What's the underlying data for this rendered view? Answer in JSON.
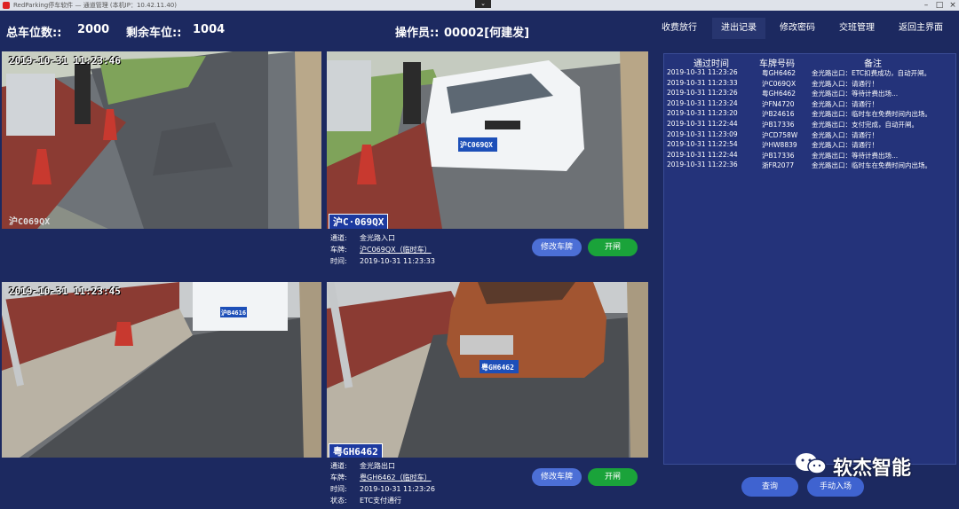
{
  "window": {
    "title": "RedParking停车软件 — 通道管理 (本机IP：10.42.11.40)",
    "controls": [
      "–",
      "□",
      "×"
    ],
    "collapse_glyph": "⌄"
  },
  "stats": {
    "total_label": "总车位数::",
    "total_value": "2000",
    "remaining_label": "剩余车位::",
    "remaining_value": "1004",
    "operator_label": "操作员::",
    "operator_value": "00002[何建发]"
  },
  "nav": {
    "items": [
      "收费放行",
      "进出记录",
      "修改密码",
      "交班管理",
      "返回主界面"
    ],
    "active": "进出记录"
  },
  "cameras": {
    "tl": {
      "timestamp": "2019-10-31 11:23:46",
      "overlay_plate": "沪C069QX"
    },
    "tr": {
      "plate_on_car": "沪C069QX",
      "overlay_plate": "沪C·069QX"
    },
    "bl": {
      "timestamp": "2019-10-31 11:23:45",
      "plate_on_car": "沪B4616"
    },
    "br": {
      "plate_on_car": "粤GH6462",
      "overlay_plate": "粤GH6462"
    }
  },
  "lane1": {
    "channel_label": "通道:",
    "channel_value": "金光路入口",
    "plate_label": "车牌:",
    "plate_value": "沪C069QX（临时车）",
    "time_label": "时间:",
    "time_value": "2019-10-31 11:23:33",
    "modify_button": "修改车牌",
    "open_button": "开闸"
  },
  "lane2": {
    "channel_label": "通道:",
    "channel_value": "金光路出口",
    "plate_label": "车牌:",
    "plate_value": "粤GH6462（临时车）",
    "time_label": "时间:",
    "time_value": "2019-10-31 11:23:26",
    "status_label": "状态:",
    "status_value": "ETC支付通行",
    "modify_button": "修改车牌",
    "open_button": "开闸"
  },
  "records": {
    "headers": [
      "通过时间",
      "车牌号码",
      "备注"
    ],
    "rows": [
      {
        "time": "2019-10-31 11:23:26",
        "plate": "粤GH6462",
        "note": "金光路出口：ETC扣费成功，自动开闸。"
      },
      {
        "time": "2019-10-31 11:23:33",
        "plate": "沪C069QX",
        "note": "金光路入口：请通行！"
      },
      {
        "time": "2019-10-31 11:23:26",
        "plate": "粤GH6462",
        "note": "金光路出口：等待计费出场..."
      },
      {
        "time": "2019-10-31 11:23:24",
        "plate": "沪FN4720",
        "note": "金光路入口：请通行！"
      },
      {
        "time": "2019-10-31 11:23:20",
        "plate": "沪B24616",
        "note": "金光路出口：临时车在免费时间内出场。"
      },
      {
        "time": "2019-10-31 11:22:44",
        "plate": "沪B17336",
        "note": "金光路出口：支付完成，自动开闸。"
      },
      {
        "time": "2019-10-31 11:23:09",
        "plate": "沪CD758W",
        "note": "金光路入口：请通行！"
      },
      {
        "time": "2019-10-31 11:22:54",
        "plate": "沪HW8839",
        "note": "金光路入口：请通行！"
      },
      {
        "time": "2019-10-31 11:22:44",
        "plate": "沪B17336",
        "note": "金光路出口：等待计费出场..."
      },
      {
        "time": "2019-10-31 11:22:36",
        "plate": "浙FR2077",
        "note": "金光路出口：临时车在免费时间内出场。"
      }
    ]
  },
  "actions": {
    "query": "查询",
    "manual_entry": "手动入场"
  },
  "watermark": {
    "text": "软杰智能",
    "icon": "wechat-icon"
  },
  "colors": {
    "background": "#1c2960",
    "panel": "#24337a",
    "blue_button": "#4c6fd6",
    "green_button": "#1aa33a"
  }
}
